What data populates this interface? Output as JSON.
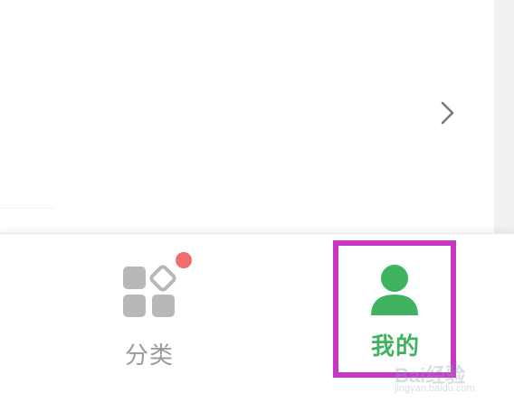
{
  "tab_bar": {
    "tabs": [
      {
        "label": "分类",
        "icon": "category-grid-icon",
        "has_badge": true,
        "color": "#9a9a9a"
      },
      {
        "label": "我的",
        "icon": "person-icon",
        "selected": true,
        "color": "#3fb35f"
      }
    ]
  },
  "content": {
    "row_chevron": "chevron-right-icon"
  },
  "annotation": {
    "highlight_color": "#c838c8",
    "target": "我的"
  },
  "watermark": {
    "text": "Bai经验",
    "subtext": "jingyan.baidu.com"
  },
  "colors": {
    "accent": "#3fb35f",
    "badge": "#f26d6d",
    "inactive": "#9a9a9a"
  }
}
